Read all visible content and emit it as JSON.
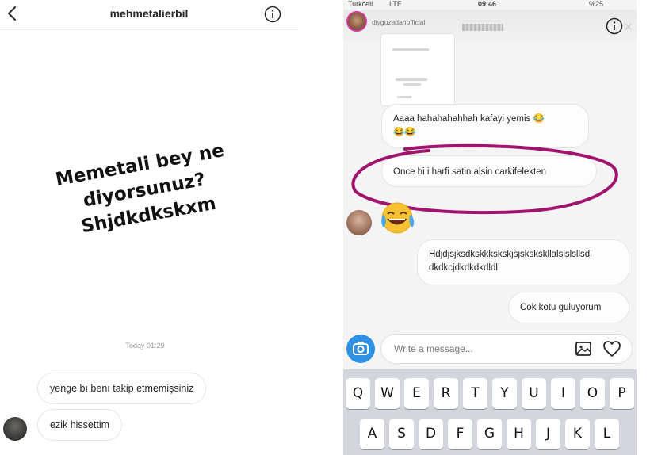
{
  "left": {
    "username": "mehmetalierbil",
    "story_text": [
      "Memetali bey ne",
      "diyorsunuz?",
      "Shjdkdkskxm"
    ],
    "timestamp": "Today 01:29",
    "messages": [
      {
        "text": "yenge bı benı takip etmemişsiniz"
      },
      {
        "text": "ezik hissettim"
      }
    ]
  },
  "right": {
    "status": {
      "carrier": "Turkcell",
      "network": "LTE",
      "time": "09:46",
      "battery": "%25"
    },
    "story_user": "diyguzadanofficial",
    "messages": [
      {
        "text": "Aaaa hahahahahhah kafayi yemis 😂",
        "line2": "😂😂"
      },
      {
        "text": "Once bi i harfi satin alsin carkifelekten"
      },
      {
        "text": "Hdjdjsjksdkskkkskskjsjskskskllalslslsllsdl",
        "line2": "dkdkcjdkdkdkdldl"
      },
      {
        "text": "Cok kotu guluyorum"
      }
    ],
    "composer": {
      "placeholder": "Write a message..."
    },
    "keyboard": {
      "row1": [
        "Q",
        "W",
        "E",
        "R",
        "T",
        "Y",
        "U",
        "I",
        "O",
        "P"
      ],
      "row2": [
        "A",
        "S",
        "D",
        "F",
        "G",
        "H",
        "J",
        "K",
        "L"
      ]
    },
    "annotation_color": "#a0146e",
    "accent_color": "#2f91e3"
  }
}
